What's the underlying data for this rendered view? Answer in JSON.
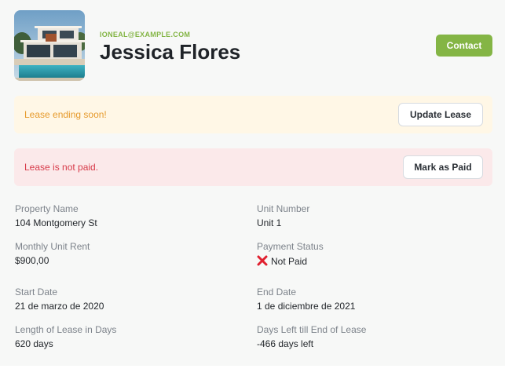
{
  "header": {
    "email": "IONEAL@EXAMPLE.COM",
    "name": "Jessica Flores",
    "contact_label": "Contact",
    "thumbnail_icon": "house-photo"
  },
  "alerts": {
    "warning": {
      "text": "Lease ending soon!",
      "button": "Update Lease",
      "color": "#e69a2c"
    },
    "error": {
      "text": "Lease is not paid.",
      "button": "Mark as Paid",
      "color": "#d73a49"
    }
  },
  "details": {
    "property_name": {
      "label": "Property Name",
      "value": "104 Montgomery St"
    },
    "unit_number": {
      "label": "Unit Number",
      "value": "Unit 1"
    },
    "monthly_rent": {
      "label": "Monthly Unit Rent",
      "value": "$900,00"
    },
    "payment_status": {
      "label": "Payment Status",
      "value": "Not Paid",
      "icon": "x-icon"
    },
    "start_date": {
      "label": "Start Date",
      "value": "21 de marzo de 2020"
    },
    "end_date": {
      "label": "End Date",
      "value": "1 de diciembre de 2021"
    },
    "lease_length": {
      "label": "Length of Lease in Days",
      "value": "620 days"
    },
    "days_left": {
      "label": "Days Left till End of Lease",
      "value": "-466 days left"
    }
  },
  "colors": {
    "accent": "#84b545",
    "warning_bg": "#fff7e6",
    "error_bg": "#fbe9ea"
  }
}
